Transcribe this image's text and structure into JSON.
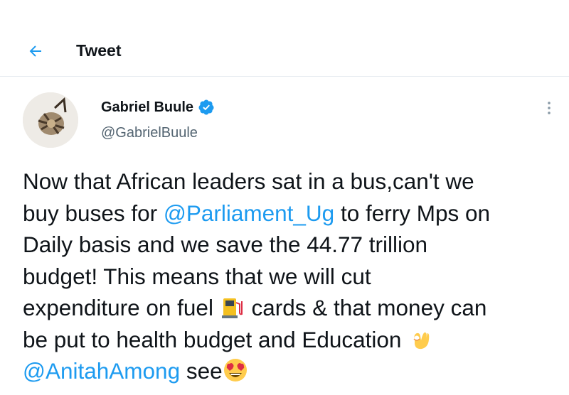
{
  "header": {
    "title": "Tweet",
    "back_icon": "arrow-left-icon"
  },
  "tweet": {
    "author": {
      "name": "Gabriel Buule",
      "handle": "@GabrielBuule",
      "verified": true
    },
    "more_icon": "more-vertical-icon",
    "text_parts": {
      "p1": "Now that African leaders sat in a bus,can't we\nbuy buses for ",
      "m1": "@Parliament_Ug",
      "p2": " to ferry Mps on\nDaily basis and we save the 44.77 trillion\nbudget! This means that we will cut\nexpenditure on fuel ",
      "p3": " cards & that money can\nbe put to health budget and Education ",
      "p4": "\n",
      "m2": "@AnitahAmong",
      "p5": "  see"
    },
    "emojis": [
      "fuel-pump-emoji",
      "ok-hand-emoji",
      "heart-eyes-emoji"
    ]
  },
  "colors": {
    "accent": "#1d9bf0",
    "text": "#0f1419",
    "secondary": "#536471",
    "divider": "#e6ecf0"
  }
}
